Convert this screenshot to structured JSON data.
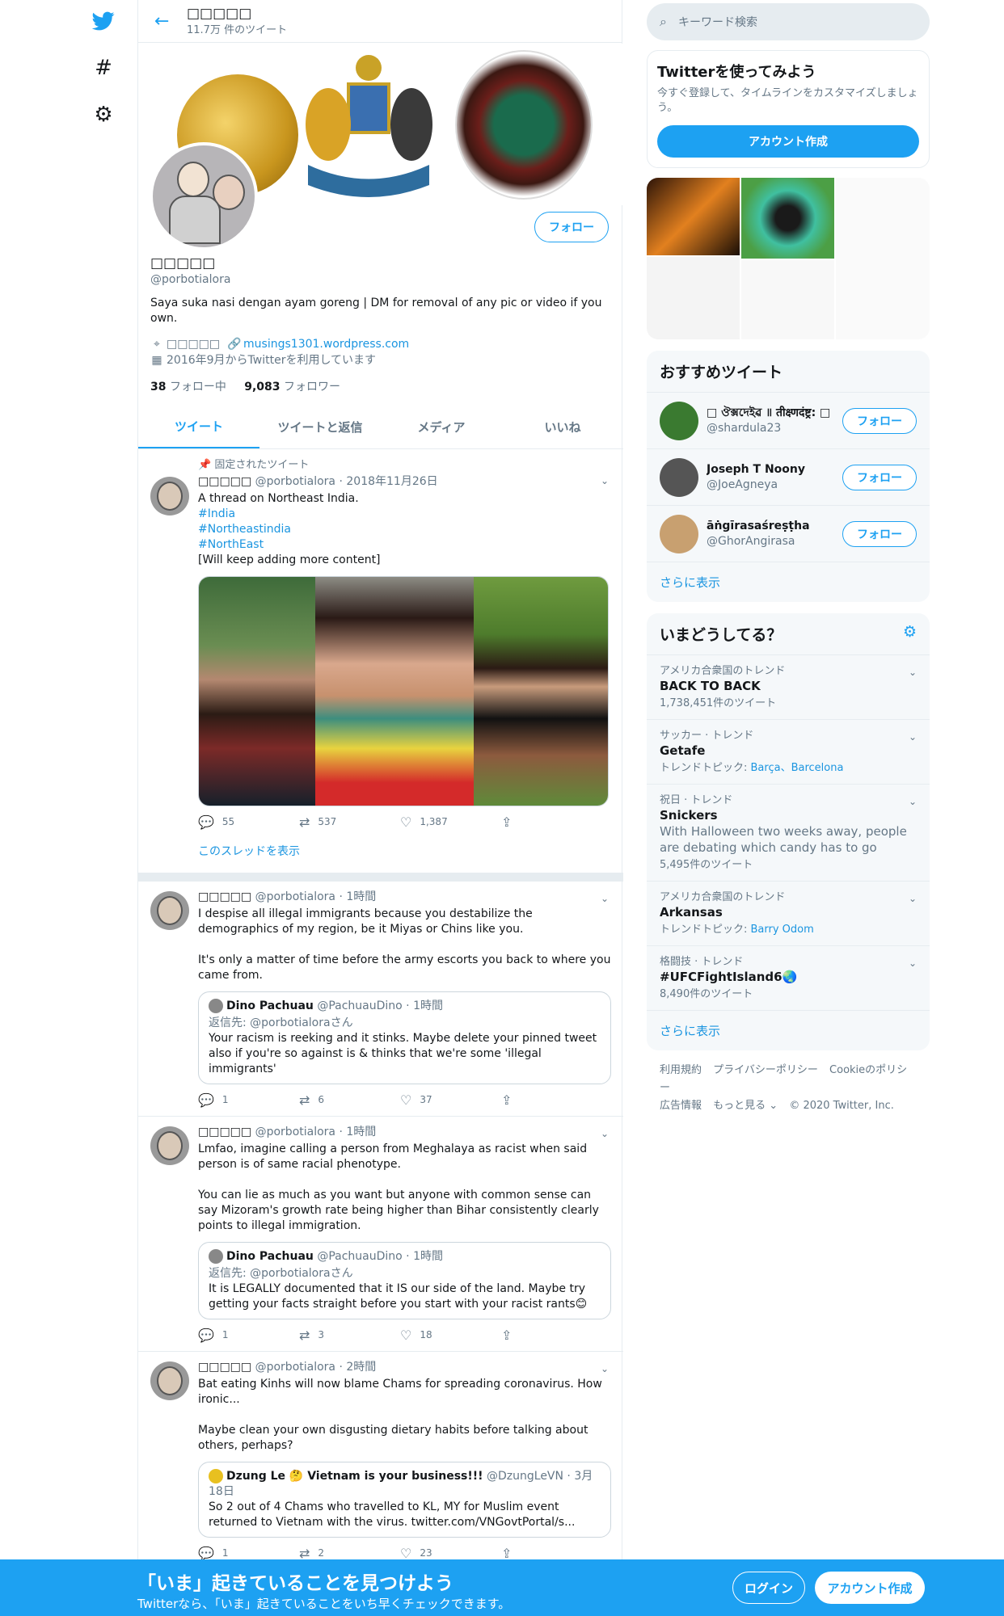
{
  "header": {
    "name": "□□□□□",
    "tweet_count": "11.7万 件のツイート"
  },
  "profile": {
    "name": "□□□□□",
    "handle": "@porbotialora",
    "bio": "Saya suka nasi dengan ayam goreng | DM for removal of any pic or video if you own.",
    "location": "□□□□□",
    "website": "musings1301.wordpress.com",
    "joined": "2016年9月からTwitterを利用しています",
    "following_count": "38",
    "following_label": "フォロー中",
    "followers_count": "9,083",
    "followers_label": "フォロワー",
    "follow_label": "フォロー"
  },
  "tabs": [
    "ツイート",
    "ツイートと返信",
    "メディア",
    "いいね"
  ],
  "tweets": [
    {
      "pinned": "固定されたツイート",
      "name": "□□□□□",
      "handle": "@porbotialora",
      "time": "2018年11月26日",
      "text": "A thread on Northeast India.",
      "tags": [
        "#India",
        "#Northeastindia",
        "#NorthEast"
      ],
      "text2": "[Will keep adding more content]",
      "replies": "55",
      "retweets": "537",
      "likes": "1,387",
      "thread_link": "このスレッドを表示"
    },
    {
      "name": "□□□□□",
      "handle": "@porbotialora",
      "time": "1時間",
      "text": "I despise all illegal immigrants because you destabilize the demographics of my region, be it Miyas or Chins like you.",
      "text2": "It's only a matter of time before the army escorts you back to where you came from.",
      "quote": {
        "name": "Dino Pachuau",
        "handle": "@PachuauDino",
        "time": "1時間",
        "reply": "返信先: @porbotialoraさん",
        "text": "Your racism is reeking and it stinks. Maybe delete your pinned tweet also if you're so against is & thinks that we're some 'illegal immigrants'"
      },
      "replies": "1",
      "retweets": "6",
      "likes": "37"
    },
    {
      "name": "□□□□□",
      "handle": "@porbotialora",
      "time": "1時間",
      "text": "Lmfao, imagine calling a person from Meghalaya as racist when said person is of same racial phenotype.",
      "text2": "You can lie as much as you want but anyone with common sense can say Mizoram's growth rate being higher than Bihar consistently clearly points to illegal immigration.",
      "quote": {
        "name": "Dino Pachuau",
        "handle": "@PachuauDino",
        "time": "1時間",
        "reply": "返信先: @porbotialoraさん",
        "text": "It is LEGALLY documented that it IS our side of the land. Maybe try getting your facts straight before you start with your racist rants😊"
      },
      "replies": "1",
      "retweets": "3",
      "likes": "18"
    },
    {
      "name": "□□□□□",
      "handle": "@porbotialora",
      "time": "2時間",
      "text": "Bat eating Kinhs will now blame Chams for spreading coronavirus. How ironic...",
      "text2": "Maybe clean your own disgusting dietary habits before talking about others, perhaps?",
      "quote": {
        "name": "Dzung Le 🤔 Vietnam is your business!!!",
        "handle": "@DzungLeVN",
        "time": "3月18日",
        "text": "So 2 out of 4 Chams who travelled to KL, MY for Muslim event returned to Vietnam with the virus. twitter.com/VNGovtPortal/s..."
      },
      "replies": "1",
      "retweets": "2",
      "likes": "23"
    }
  ],
  "right": {
    "search_placeholder": "キーワード検索",
    "use_title": "Twitterを使ってみよう",
    "use_desc": "今すぐ登録して、タイムラインをカスタマイズしましょう。",
    "create_account": "アカウント作成",
    "rec_title": "おすすめツイート",
    "recs": [
      {
        "name": "□ ঔক্সদেইৱ ॥ तीक्ष्णदंष्ट्र: □",
        "handle": "@shardula23",
        "color": "#3a7a30"
      },
      {
        "name": "Joseph T Noony",
        "handle": "@JoeAgneya",
        "color": "#555555"
      },
      {
        "name": "āṅgīrasaśreṣṭha",
        "handle": "@GhorAngirasa",
        "color": "#c8a070"
      }
    ],
    "follow_label": "フォロー",
    "show_more": "さらに表示",
    "trends_title": "いまどうしてる？",
    "trends": [
      {
        "context": "アメリカ合衆国のトレンド",
        "name": "BACK TO BACK",
        "count": "1,738,451件のツイート"
      },
      {
        "context": "サッカー · トレンド",
        "name": "Getafe",
        "topic_label": "トレンドトピック: ",
        "topics": "Barça、Barcelona"
      },
      {
        "context": "祝日 · トレンド",
        "name": "Snickers",
        "desc": "With Halloween two weeks away, people are debating which candy has to go",
        "count": "5,495件のツイート"
      },
      {
        "context": "アメリカ合衆国のトレンド",
        "name": "Arkansas",
        "topic_label": "トレンドトピック: ",
        "topics": "Barry Odom"
      },
      {
        "context": "格闘技 · トレンド",
        "name": "#UFCFightIsland6🌏",
        "count": "8,490件のツイート"
      }
    ],
    "footer": [
      "利用規約",
      "プライバシーポリシー",
      "Cookieのポリシー",
      "広告情報",
      "もっと見る ⌄",
      "© 2020 Twitter, Inc."
    ]
  },
  "bottom": {
    "title": "「いま」起きていることを見つけよう",
    "subtitle": "Twitterなら、「いま」起きていることをいち早くチェックできます。",
    "login": "ログイン",
    "signup": "アカウント作成"
  },
  "colors": {
    "accent": "#1da1f2",
    "link": "#1b95e0",
    "muted": "#657786"
  }
}
